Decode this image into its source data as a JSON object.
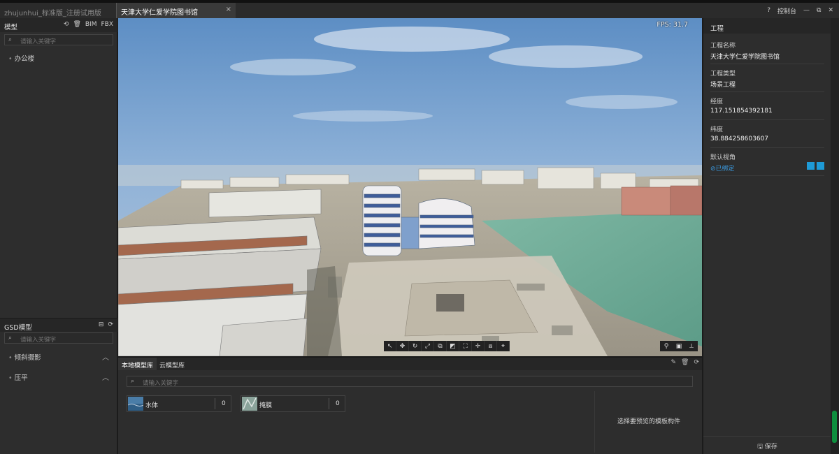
{
  "titlebar": {
    "app_title": "zhujunhui_标准版_注册试用版",
    "tab_label": "天津大学仁爱学院图书馆",
    "tab_close": "×",
    "help": "?",
    "console": "控制台",
    "minimize": "—",
    "restore": "⧉",
    "close": "✕"
  },
  "left": {
    "model_title": "模型",
    "model_tools": [
      "⟲",
      "🗑",
      "BIM",
      "FBX"
    ],
    "search_placeholder": "请输入关键字",
    "tree_items": [
      "办公楼"
    ],
    "gsd_title": "GSD模型",
    "gsd_tools": [
      "⊟",
      "⟳"
    ],
    "gsd_search_placeholder": "请输入关键字",
    "gsd_groups": [
      "倾斜摄影",
      "压平"
    ]
  },
  "viewport": {
    "fps": "FPS: 31.7",
    "toolbar_icons": [
      "arrow-select",
      "move",
      "rotate",
      "scale",
      "copy",
      "clip",
      "frame",
      "pan",
      "layer",
      "fit"
    ],
    "toolbar_right_icons": [
      "location",
      "screenshot",
      "measure"
    ]
  },
  "library": {
    "tabs": [
      "本地模型库",
      "云模型库"
    ],
    "search_placeholder": "请输入关键字",
    "items": [
      {
        "name": "水体",
        "count": "0"
      },
      {
        "name": "掩膜",
        "count": "0"
      }
    ],
    "preview_hint": "选择要预览的模板构件"
  },
  "right": {
    "title": "工程",
    "props": [
      {
        "key": "工程名称",
        "value": "天津大学仁爱学院图书馆"
      },
      {
        "key": "工程类型",
        "value": "场景工程"
      },
      {
        "key": "经度",
        "value": "117.151854392181"
      },
      {
        "key": "纬度",
        "value": "38.884258603607"
      },
      {
        "key": "默认视角",
        "value": "⊘已绑定"
      }
    ],
    "save_label": "保存"
  },
  "colors": {
    "accent": "#1e9ad6",
    "link": "#3a9ae0",
    "panel": "#2d2d2d",
    "header": "#262626"
  }
}
